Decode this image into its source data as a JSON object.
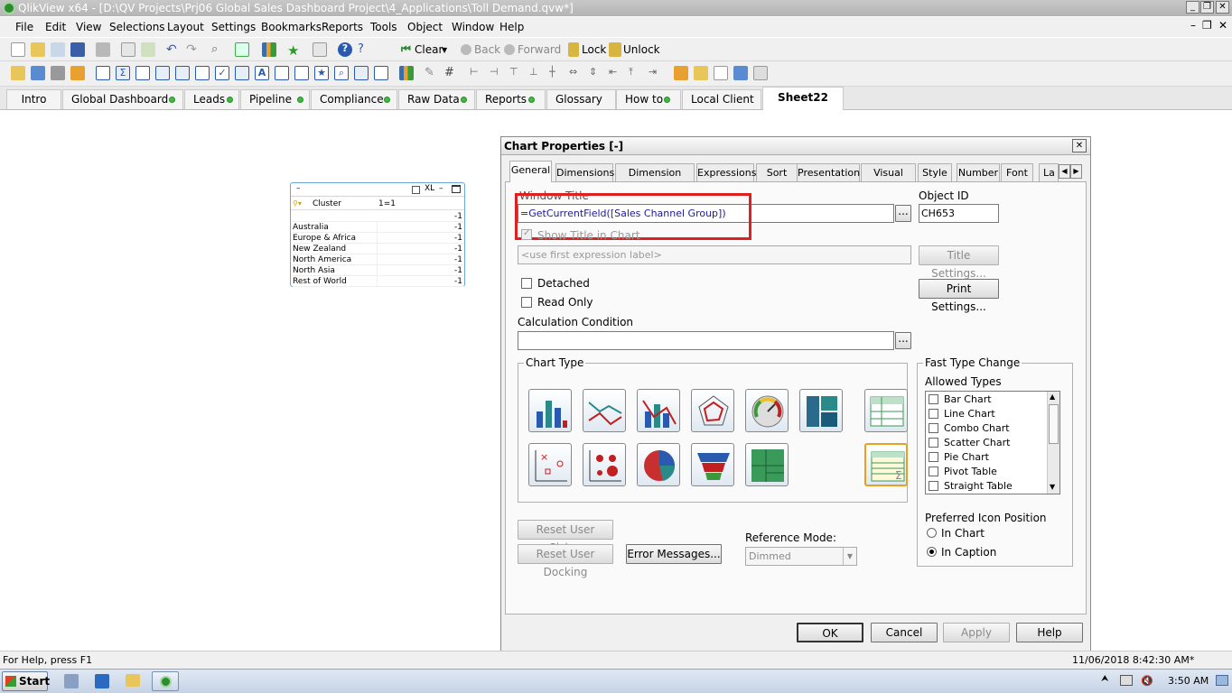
{
  "window": {
    "title": "QlikView x64 - [D:\\QV Projects\\Prj06 Global Sales Dashboard Project\\4_Applications\\Toll Demand.qvw*]"
  },
  "menu": [
    "File",
    "Edit",
    "View",
    "Selections",
    "Layout",
    "Settings",
    "Bookmarks",
    "Reports",
    "Tools",
    "Object",
    "Window",
    "Help"
  ],
  "toolbar": {
    "clear": "Clear",
    "back": "Back",
    "forward": "Forward",
    "lock": "Lock",
    "unlock": "Unlock"
  },
  "tabs": [
    {
      "label": "Intro",
      "dot": false
    },
    {
      "label": "Global Dashboard",
      "dot": true
    },
    {
      "label": "Leads",
      "dot": true
    },
    {
      "label": "Pipeline",
      "dot": true
    },
    {
      "label": "Compliance",
      "dot": true
    },
    {
      "label": "Raw Data",
      "dot": true
    },
    {
      "label": "Reports",
      "dot": true
    },
    {
      "label": "Glossary",
      "dot": false
    },
    {
      "label": "How to",
      "dot": true
    },
    {
      "label": "Local Client",
      "dot": false
    },
    {
      "label": "Sheet22",
      "dot": false
    }
  ],
  "table_box": {
    "caption_icons": "XL",
    "col1": "Cluster",
    "col2": "1=1",
    "total": "-1",
    "rows": [
      {
        "cluster": "Australia",
        "value": "-1"
      },
      {
        "cluster": "Europe & Africa",
        "value": "-1"
      },
      {
        "cluster": "New Zealand",
        "value": "-1"
      },
      {
        "cluster": "North America",
        "value": "-1"
      },
      {
        "cluster": "North Asia",
        "value": "-1"
      },
      {
        "cluster": "Rest of World",
        "value": "-1"
      }
    ]
  },
  "dialog": {
    "title": "Chart Properties [-]",
    "tabs": [
      "General",
      "Dimensions",
      "Dimension Limits",
      "Expressions",
      "Sort",
      "Presentation",
      "Visual Cues",
      "Style",
      "Number",
      "Font",
      "La"
    ],
    "window_title_label": "Window Title",
    "window_title_value": "=GetCurrentField([Sales Channel Group])",
    "show_title_label": "Show Title in Chart",
    "title_placeholder": "<use first expression label>",
    "object_id_label": "Object ID",
    "object_id_value": "CH653",
    "title_settings": "Title Settings...",
    "print_settings": "Print Settings...",
    "detached": "Detached",
    "read_only": "Read Only",
    "calc_condition": "Calculation Condition",
    "chart_type_label": "Chart Type",
    "fast_type_change": "Fast Type Change",
    "allowed_types_label": "Allowed Types",
    "allowed_types": [
      "Bar Chart",
      "Line Chart",
      "Combo Chart",
      "Scatter Chart",
      "Pie Chart",
      "Pivot Table",
      "Straight Table"
    ],
    "icon_position_label": "Preferred Icon Position",
    "in_chart": "In Chart",
    "in_caption": "In Caption",
    "reset_sizing": "Reset User Sizing",
    "reset_docking": "Reset User Docking",
    "error_messages": "Error Messages...",
    "reference_mode_label": "Reference Mode:",
    "reference_mode_value": "Dimmed",
    "ok": "OK",
    "cancel": "Cancel",
    "apply": "Apply",
    "help": "Help",
    "ellipsis": "...",
    "highlight_color": "#e02020"
  },
  "status": {
    "help": "For Help, press F1",
    "datetime": "11/06/2018 8:42:30 AM*"
  },
  "taskbar": {
    "start": "Start",
    "clock": "3:50 AM"
  }
}
